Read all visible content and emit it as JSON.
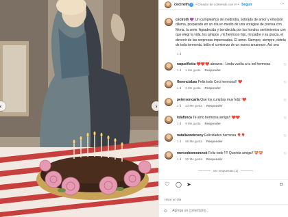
{
  "post": {
    "username": "ceciroth",
    "verified_glyph": "✓",
    "subtitle": "• Creador de contenido con IA •",
    "follow_label": "Seguir",
    "more_glyph": "···",
    "caption_user": "ceciroth",
    "caption": "💜 Un cumpleaños de mediodía, sobrado de amor y emoción diluma, preparado en un día en medio de una vorágine de prensa con Moria, la serie. Agradecida y bendecida por los hondos sentimientos con que elegí la vida, los amigos , mi hermoso hijo, mi padre y su gracia, el devenir de las sorpresas impensadas. El amor. Siempre, siempre, detrás de toda tormenta, brilla el comienzo de un nuevo amanecer. Así sea",
    "caption_time": "1 d",
    "time_ago": "Hace un día",
    "add_comment_placeholder": "Agrega un comentario..."
  },
  "comments": [
    {
      "user": "raquelflotta",
      "text": "❤️❤️❤️ abrazos . Linda vuelta a tu sol hermosa",
      "time": "1 d",
      "likes": "1 Me gusta",
      "reply": "Responder"
    },
    {
      "user": "florenciabas",
      "text": "Feliz todo Ceci hermosa!! ❤️",
      "time": "1 d",
      "likes": "6 Me gusta",
      "reply": "Responder"
    },
    {
      "user": "petersoncarla",
      "text": "Que los cumplas muy feliz! ❤️",
      "time": "1 d",
      "likes": "14 Me gusta",
      "reply": "Responder"
    },
    {
      "user": "lolafonca",
      "text": "Te amo hermosa amiga!! ❤️❤️",
      "time": "1 d",
      "likes": "9 Me gusta",
      "reply": "Responder"
    },
    {
      "user": "nataliaoreirosoy",
      "text": "Felicidades hermosa 🎈🎈",
      "time": "1 d",
      "likes": "65 Me gusta",
      "reply": "Responder"
    },
    {
      "user": "mercedesmoranok",
      "text": "Feliz todo !!!! Querida amiga!! 💝💝",
      "time": "1 d",
      "likes": "52 Me gusta",
      "reply": "Responder"
    }
  ],
  "hidden_replies_label": "Ver respuestas (1)",
  "icons": {
    "heart": "♡",
    "comment": "◯",
    "share": "➤",
    "save": "⌑",
    "emoji": "☺",
    "prev": "‹",
    "next": "›"
  },
  "colors": {
    "accent": "#0095f6",
    "verified": "#3897f0",
    "heart_red": "#ed4956",
    "muted": "#737373"
  }
}
